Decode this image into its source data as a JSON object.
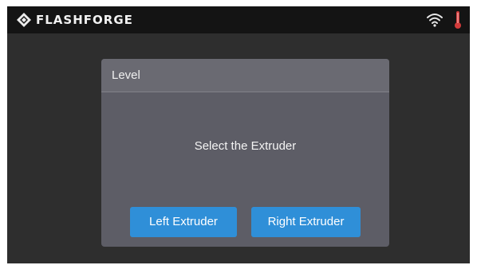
{
  "status_bar": {
    "brand": "FLASHFORGE",
    "icons": {
      "logo": "flashforge-logo-icon",
      "wifi": "wifi-icon",
      "temperature": "thermometer-icon"
    }
  },
  "dialog": {
    "title": "Level",
    "message": "Select the Extruder",
    "buttons": {
      "left": "Left Extruder",
      "right": "Right Extruder"
    }
  },
  "colors": {
    "screen_background": "#2e2e2e",
    "status_bar": "#141414",
    "dialog_background": "#5d5d66",
    "button": "#2f8fd8",
    "thermometer": "#d23b3b"
  }
}
